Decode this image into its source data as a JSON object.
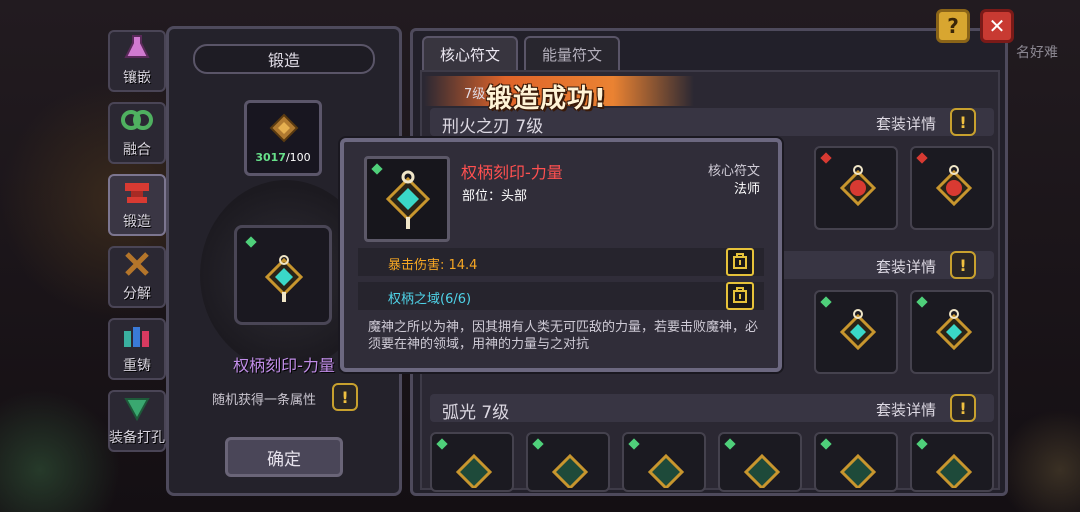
{
  "sidebar": {
    "items": [
      {
        "label": "镶嵌",
        "icon": "flask-icon",
        "active": false
      },
      {
        "label": "融合",
        "icon": "loop-icon",
        "active": false
      },
      {
        "label": "锻造",
        "icon": "anvil-icon",
        "active": true
      },
      {
        "label": "分解",
        "icon": "hammers-icon",
        "active": false
      },
      {
        "label": "重铸",
        "icon": "potions-icon",
        "active": false
      },
      {
        "label": "装备打孔",
        "icon": "drill-icon",
        "active": false
      }
    ]
  },
  "forge": {
    "title": "锻造",
    "material_count": "3017",
    "material_required": "/100",
    "item_name": "权柄刻印-力量",
    "note": "随机获得一条属性",
    "confirm_label": "确定"
  },
  "tabs": [
    {
      "label": "核心符文",
      "active": true
    },
    {
      "label": "能量符文",
      "active": false
    }
  ],
  "banner": {
    "text": "锻造成功!",
    "underlay_fragment": "7级"
  },
  "rows": [
    {
      "title": "刑火之刃 7级",
      "detail_label": "套装详情"
    },
    {
      "title": "",
      "detail_label": "套装详情"
    },
    {
      "title": "弧光 7级",
      "detail_label": "套装详情"
    }
  ],
  "popup": {
    "item_name": "权柄刻印-力量",
    "slot_label": "部位：头部",
    "rune_type": "核心符文",
    "class_name": "法师",
    "stats": [
      {
        "text": "暴击伤害: 14.4",
        "color": "#f5a623"
      },
      {
        "text": "权柄之域(6/6)",
        "color": "#4fd3e8"
      }
    ],
    "description": "魔神之所以为神，因其拥有人类无可匹敌的力量，若要击败魔神，必须要在神的领域，用神的力量与之对抗"
  },
  "top_right": {
    "help_label": "?",
    "close_label": "✕",
    "player_name": "名好难"
  },
  "colors": {
    "accent_gold": "#e6c23a",
    "rare_red": "#ff5050",
    "epic_purple": "#c18de8",
    "stat_orange": "#f5a623",
    "set_cyan": "#4fd3e8"
  }
}
